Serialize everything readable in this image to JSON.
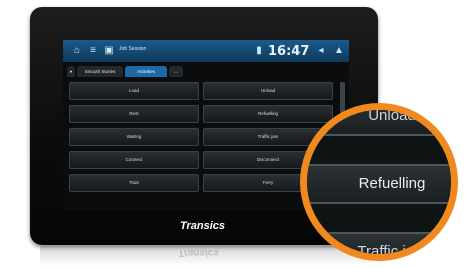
{
  "topbar": {
    "title": "Job Session",
    "time": "16:47"
  },
  "tabs": [
    {
      "label": "Smooth Stories"
    },
    {
      "label": "Activities"
    },
    {
      "label": "…"
    }
  ],
  "buttons": [
    {
      "label": "Load"
    },
    {
      "label": "Unload"
    },
    {
      "label": "Rest"
    },
    {
      "label": "Refuelling"
    },
    {
      "label": "Waiting"
    },
    {
      "label": "Traffic jam"
    },
    {
      "label": "Connect"
    },
    {
      "label": "Disconnect"
    },
    {
      "label": "Train"
    },
    {
      "label": "Ferry"
    }
  ],
  "brand": "Transics",
  "magnifier": {
    "top_label": "Unload",
    "center_label": "Refuelling",
    "bottom_label": "Traffic jam"
  },
  "colors": {
    "accent": "#f08a1e",
    "topbar": "#1a5a8a"
  }
}
